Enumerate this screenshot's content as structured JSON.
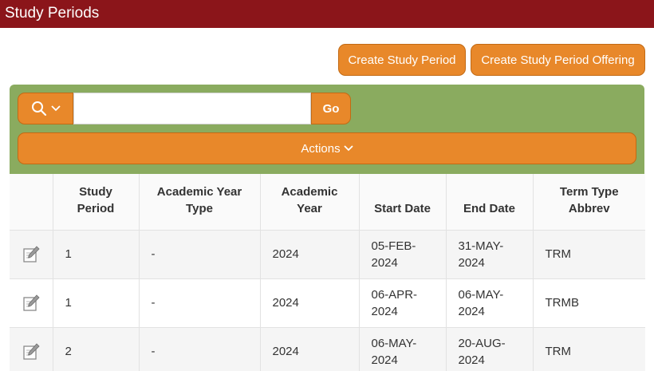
{
  "header": {
    "title": "Study Periods"
  },
  "toolbar": {
    "create_study_period_label": "Create Study Period",
    "create_offering_label": "Create Study Period Offering"
  },
  "search": {
    "value": "",
    "go_label": "Go"
  },
  "actions": {
    "label": "Actions"
  },
  "table": {
    "columns": {
      "study_period": [
        "Study",
        "Period"
      ],
      "academic_year_type": [
        "Academic Year",
        "Type"
      ],
      "academic_year": [
        "Academic",
        "Year"
      ],
      "start_date": [
        "Start Date"
      ],
      "end_date": [
        "End Date"
      ],
      "term_type_abbrev": [
        "Term Type",
        "Abbrev"
      ]
    },
    "rows": [
      {
        "study_period": "1",
        "academic_year_type": "-",
        "academic_year": "2024",
        "start_date": [
          "05-FEB-",
          "2024"
        ],
        "end_date": [
          "31-MAY-",
          "2024"
        ],
        "term_type_abbrev": "TRM"
      },
      {
        "study_period": "1",
        "academic_year_type": "-",
        "academic_year": "2024",
        "start_date": [
          "06-APR-",
          "2024"
        ],
        "end_date": [
          "06-MAY-",
          "2024"
        ],
        "term_type_abbrev": "TRMB"
      },
      {
        "study_period": "2",
        "academic_year_type": "-",
        "academic_year": "2024",
        "start_date": [
          "06-MAY-",
          "2024"
        ],
        "end_date": [
          "20-AUG-",
          "2024"
        ],
        "term_type_abbrev": "TRM"
      }
    ]
  },
  "colors": {
    "header_bg": "#8b151a",
    "accent_orange": "#e8882a",
    "panel_green": "#8aab5f"
  },
  "icons": {
    "search": "search-icon",
    "chevron": "chevron-down-icon",
    "edit": "edit-icon"
  }
}
